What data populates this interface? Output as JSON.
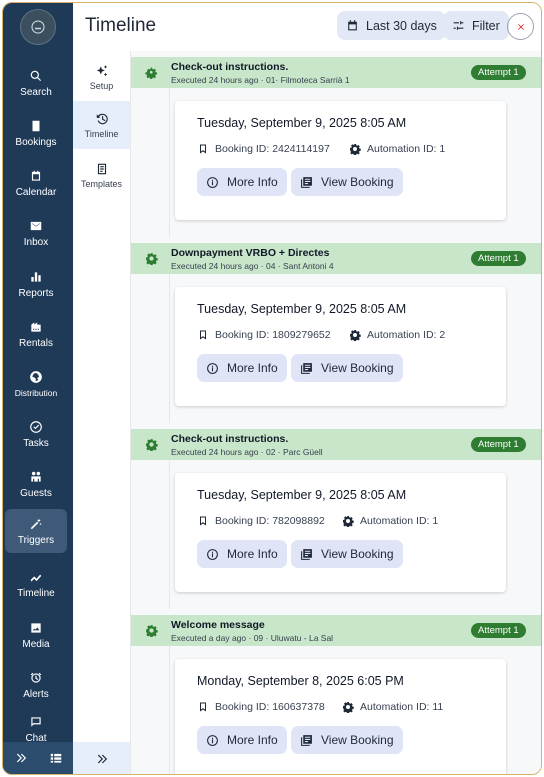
{
  "header": {
    "title": "Timeline",
    "range_label": "Last 30 days",
    "filter_label": "Filter"
  },
  "nav": {
    "items": [
      {
        "label": "Search"
      },
      {
        "label": "Bookings"
      },
      {
        "label": "Calendar"
      },
      {
        "label": "Inbox"
      },
      {
        "label": "Reports"
      },
      {
        "label": "Rentals"
      },
      {
        "label": "Distribution"
      },
      {
        "label": "Tasks"
      },
      {
        "label": "Guests"
      },
      {
        "label": "Triggers"
      },
      {
        "label": "Timeline"
      },
      {
        "label": "Media"
      },
      {
        "label": "Alerts"
      },
      {
        "label": "Chat"
      }
    ],
    "active": "Triggers"
  },
  "subnav": {
    "items": [
      {
        "label": "Setup"
      },
      {
        "label": "Timeline"
      },
      {
        "label": "Templates"
      }
    ],
    "active": "Timeline"
  },
  "events": [
    {
      "title": "Check-out instructions.",
      "subtitle": "Executed 24 hours ago · 01· Filmoteca Sarrià 1",
      "attempt": "Attempt 1",
      "date": "Tuesday, September 9, 2025 8:05 AM",
      "booking": "Booking ID: 2424114197",
      "automation": "Automation ID: 1",
      "more_info": "More Info",
      "view_booking": "View Booking"
    },
    {
      "title": "Downpayment VRBO + Directes",
      "subtitle": "Executed 24 hours ago · 04 · Sant Antoni 4",
      "attempt": "Attempt 1",
      "date": "Tuesday, September 9, 2025 8:05 AM",
      "booking": "Booking ID: 1809279652",
      "automation": "Automation ID: 2",
      "more_info": "More Info",
      "view_booking": "View Booking"
    },
    {
      "title": "Check-out instructions.",
      "subtitle": "Executed 24 hours ago · 02 · Parc Güell",
      "attempt": "Attempt 1",
      "date": "Tuesday, September 9, 2025 8:05 AM",
      "booking": "Booking ID: 782098892",
      "automation": "Automation ID: 1",
      "more_info": "More Info",
      "view_booking": "View Booking"
    },
    {
      "title": "Welcome message",
      "subtitle": "Executed a day ago · 09 · Uluwatu - La Sal",
      "attempt": "Attempt 1",
      "date": "Monday, September 8, 2025 6:05 PM",
      "booking": "Booking ID: 160637378",
      "automation": "Automation ID: 11",
      "more_info": "More Info",
      "view_booking": "View Booking"
    }
  ],
  "colors": {
    "nav_bg": "#1f3a57",
    "event_header_bg": "#c8e6c9",
    "attempt_badge": "#2e7d32",
    "button_bg": "#dfe5f6",
    "frame_border": "#d9b26a"
  }
}
